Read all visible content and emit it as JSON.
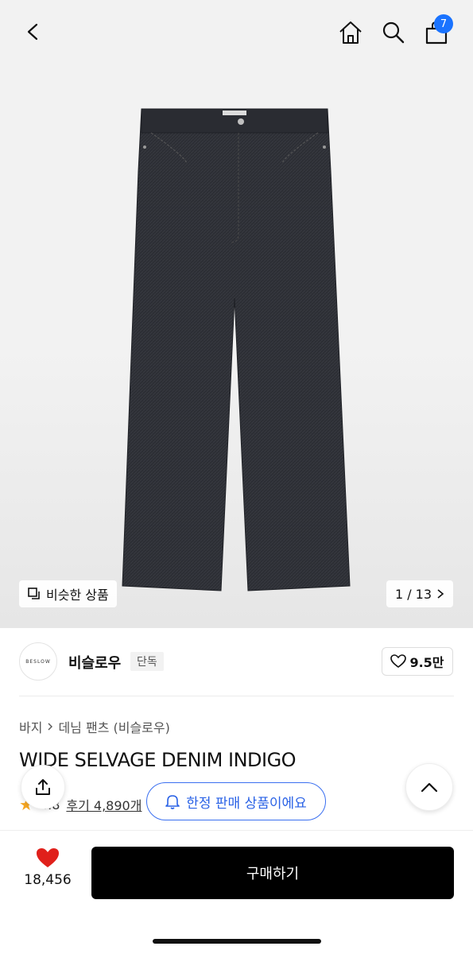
{
  "header": {
    "cart_count": "7"
  },
  "gallery": {
    "similar_label": "비슷한 상품",
    "counter": "1 / 13"
  },
  "brand": {
    "logo_text": "BESLOW",
    "name": "비슬로우",
    "badge": "단독",
    "likes": "9.5만"
  },
  "breadcrumb": {
    "category": "바지",
    "subcategory": "데님 팬츠 (비슬로우)"
  },
  "product": {
    "title": "WIDE SELVAGE DENIM INDIGO",
    "rating_partial": "4.8",
    "reviews": "후기 4,890개"
  },
  "notice": {
    "limited_label": "한정 판매 상품이에요"
  },
  "bottom": {
    "heart_count": "18,456",
    "buy_label": "구매하기"
  },
  "colors": {
    "accent_blue": "#1a73ff",
    "heart_red": "#e0201b",
    "denim": "#2b2d33"
  }
}
